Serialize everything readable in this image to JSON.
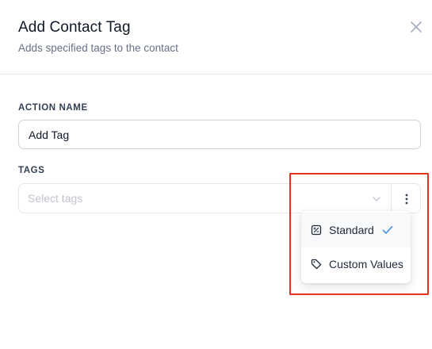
{
  "header": {
    "title": "Add Contact Tag",
    "subtitle": "Adds specified tags to the contact",
    "close_icon": "close-icon"
  },
  "action_name": {
    "label": "ACTION NAME",
    "value": "Add Tag"
  },
  "tags": {
    "label": "TAGS",
    "placeholder": "Select tags",
    "chevron_icon": "chevron-down-icon",
    "more_icon": "more-vertical-icon"
  },
  "dropdown": {
    "items": [
      {
        "label": "Standard",
        "icon": "standard-tag-icon",
        "selected": true
      },
      {
        "label": "Custom Values",
        "icon": "tag-icon",
        "selected": false
      }
    ],
    "check_icon": "check-icon"
  },
  "colors": {
    "highlight": "#e8321f",
    "check": "#4a90e2",
    "title": "#101828",
    "muted": "#667085"
  }
}
